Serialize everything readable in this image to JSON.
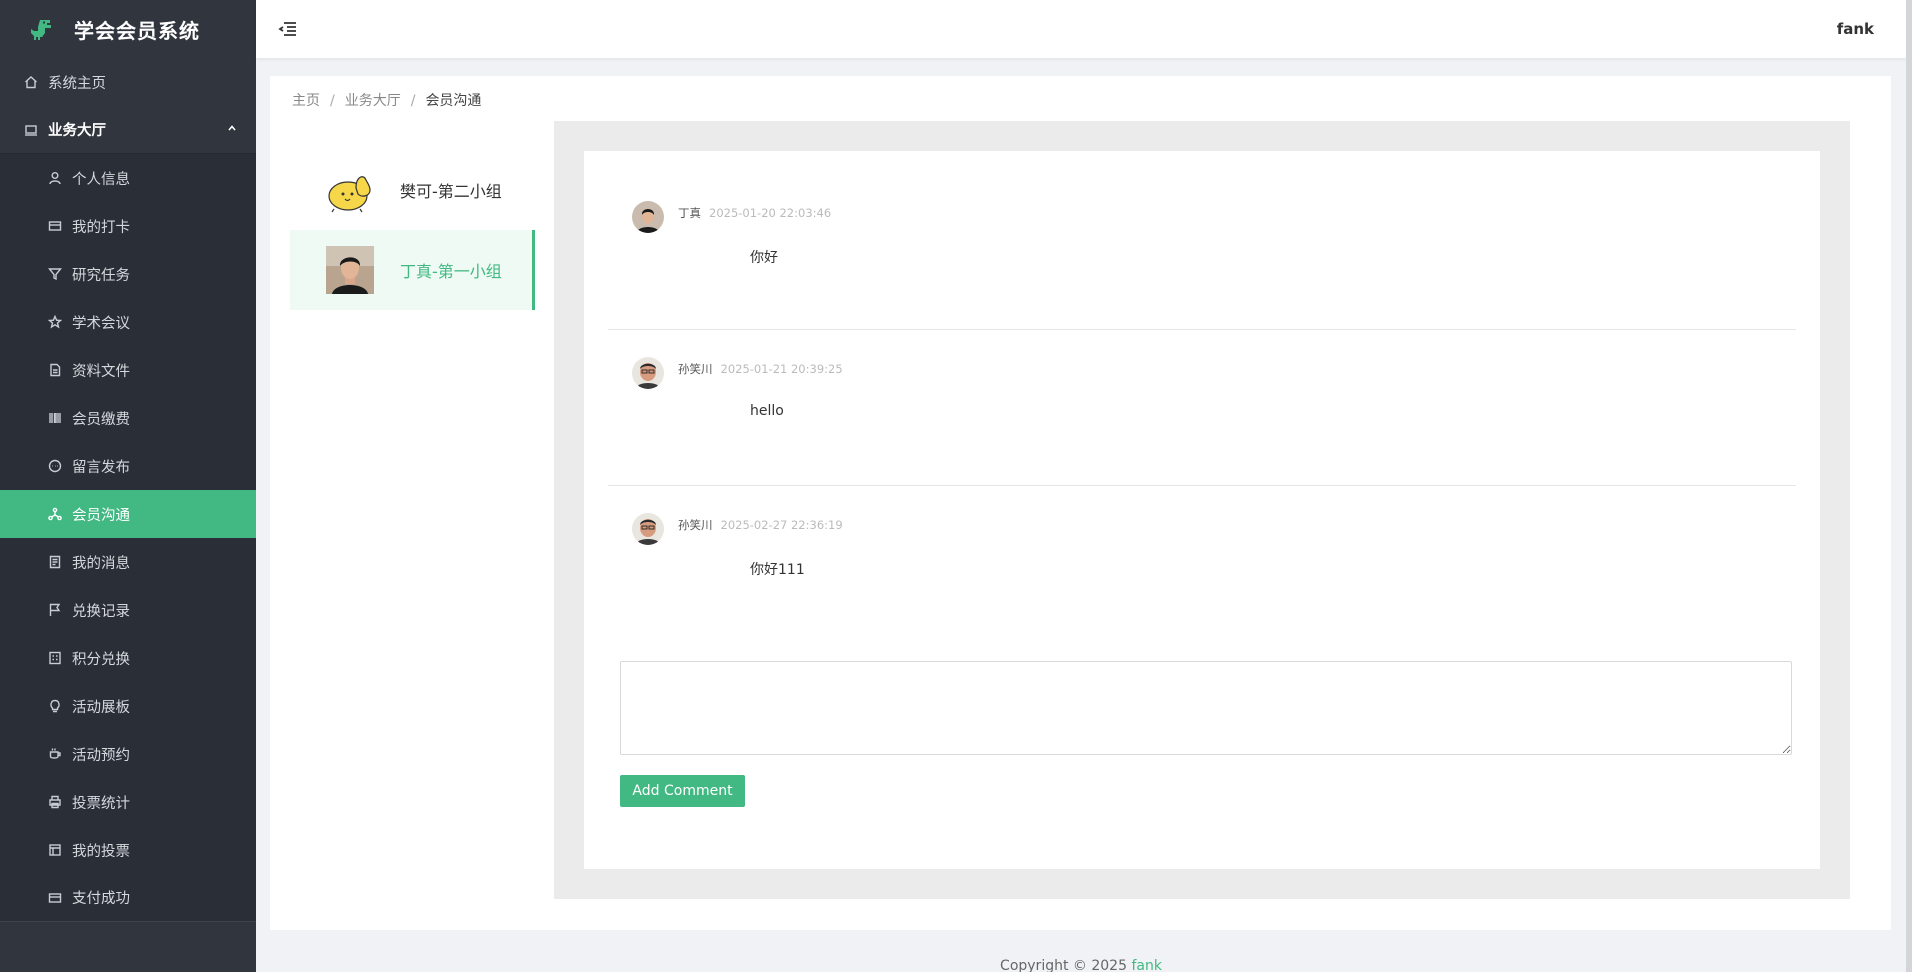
{
  "app": {
    "title": "学会会员系统"
  },
  "sidebar": {
    "home": "系统主页",
    "group": "业务大厅",
    "items": [
      {
        "label": "个人信息",
        "icon": "user-icon"
      },
      {
        "label": "我的打卡",
        "icon": "card-icon"
      },
      {
        "label": "研究任务",
        "icon": "filter-icon"
      },
      {
        "label": "学术会议",
        "icon": "star-icon"
      },
      {
        "label": "资料文件",
        "icon": "document-icon"
      },
      {
        "label": "会员缴费",
        "icon": "barcode-icon"
      },
      {
        "label": "留言发布",
        "icon": "chat-icon"
      },
      {
        "label": "会员沟通",
        "icon": "network-icon"
      },
      {
        "label": "我的消息",
        "icon": "receipt-icon"
      },
      {
        "label": "兑换记录",
        "icon": "flag-icon"
      },
      {
        "label": "积分兑换",
        "icon": "calculator-icon"
      },
      {
        "label": "活动展板",
        "icon": "bulb-icon"
      },
      {
        "label": "活动预约",
        "icon": "cup-icon"
      },
      {
        "label": "投票统计",
        "icon": "printer-icon"
      },
      {
        "label": "我的投票",
        "icon": "list-icon"
      },
      {
        "label": "支付成功",
        "icon": "card-icon"
      }
    ],
    "active_index": 7
  },
  "header": {
    "user": "fank"
  },
  "breadcrumb": {
    "home": "主页",
    "section": "业务大厅",
    "current": "会员沟通",
    "separator": "/"
  },
  "contacts": [
    {
      "name": "樊可-第二小组",
      "active": false
    },
    {
      "name": "丁真-第一小组",
      "active": true
    }
  ],
  "messages": [
    {
      "author": "丁真",
      "time": "2025-01-20 22:03:46",
      "text": "你好"
    },
    {
      "author": "孙笑川",
      "time": "2025-01-21 20:39:25",
      "text": "hello"
    },
    {
      "author": "孙笑川",
      "time": "2025-02-27 22:36:19",
      "text": "你好111"
    }
  ],
  "composer": {
    "value": "",
    "button": "Add Comment"
  },
  "footer": {
    "prefix": "Copyright © 2025 ",
    "brand": "fank"
  },
  "colors": {
    "accent": "#42b983",
    "sidebar_bg": "#30353e"
  }
}
